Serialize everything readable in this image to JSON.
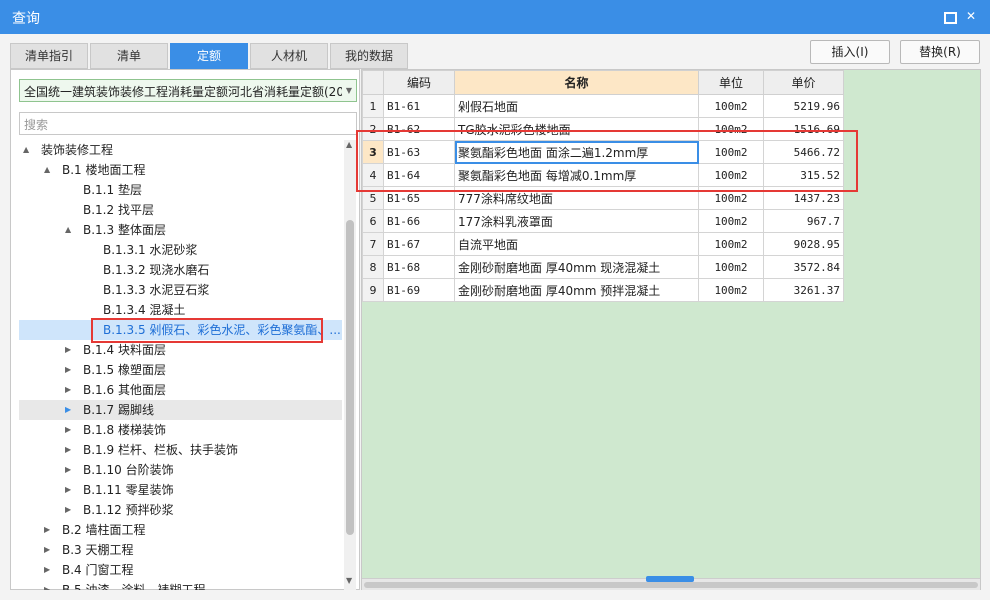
{
  "window": {
    "title": "查询"
  },
  "tabs": [
    {
      "label": "清单指引",
      "active": false
    },
    {
      "label": "清单",
      "active": false
    },
    {
      "label": "定额",
      "active": true
    },
    {
      "label": "人材机",
      "active": false
    },
    {
      "label": "我的数据",
      "active": false
    }
  ],
  "actions": {
    "insert_label": "插入(I)",
    "replace_label": "替换(R)"
  },
  "library": {
    "selected": "全国统一建筑装饰装修工程消耗量定额河北省消耗量定额(20"
  },
  "search": {
    "placeholder": "搜索"
  },
  "tree": [
    {
      "label": "装饰装修工程",
      "arrow": "▲",
      "level": 0
    },
    {
      "label": "B.1 楼地面工程",
      "arrow": "▲",
      "level": 1
    },
    {
      "label": "B.1.1 垫层",
      "arrow": "",
      "level": 2
    },
    {
      "label": "B.1.2 找平层",
      "arrow": "",
      "level": 2
    },
    {
      "label": "B.1.3 整体面层",
      "arrow": "▲",
      "level": 2
    },
    {
      "label": "B.1.3.1 水泥砂浆",
      "arrow": "",
      "level": 3
    },
    {
      "label": "B.1.3.2 现浇水磨石",
      "arrow": "",
      "level": 3
    },
    {
      "label": "B.1.3.3 水泥豆石浆",
      "arrow": "",
      "level": 3
    },
    {
      "label": "B.1.3.4 混凝土",
      "arrow": "",
      "level": 3
    },
    {
      "label": "B.1.3.5 剁假石、彩色水泥、彩色聚氨酯、...",
      "arrow": "",
      "level": 3,
      "selected": true
    },
    {
      "label": "B.1.4 块料面层",
      "arrow": "▶",
      "level": 2
    },
    {
      "label": "B.1.5 橡塑面层",
      "arrow": "▶",
      "level": 2
    },
    {
      "label": "B.1.6 其他面层",
      "arrow": "▶",
      "level": 2
    },
    {
      "label": "B.1.7 踢脚线",
      "arrow": "▶",
      "level": 2,
      "hover": true
    },
    {
      "label": "B.1.8 楼梯装饰",
      "arrow": "▶",
      "level": 2
    },
    {
      "label": "B.1.9 栏杆、栏板、扶手装饰",
      "arrow": "▶",
      "level": 2
    },
    {
      "label": "B.1.10 台阶装饰",
      "arrow": "▶",
      "level": 2
    },
    {
      "label": "B.1.11 零星装饰",
      "arrow": "▶",
      "level": 2
    },
    {
      "label": "B.1.12 预拌砂浆",
      "arrow": "▶",
      "level": 2
    },
    {
      "label": "B.2 墙柱面工程",
      "arrow": "▶",
      "level": 1
    },
    {
      "label": "B.3 天棚工程",
      "arrow": "▶",
      "level": 1
    },
    {
      "label": "B.4 门窗工程",
      "arrow": "▶",
      "level": 1
    },
    {
      "label": "B.5 油漆、涂料、裱糊工程",
      "arrow": "▶",
      "level": 1
    }
  ],
  "grid": {
    "columns": [
      "编码",
      "名称",
      "单位",
      "单价"
    ],
    "rows": [
      {
        "index": "1",
        "code": "B1-61",
        "name": "剁假石地面",
        "unit": "100m2",
        "price": "5219.96"
      },
      {
        "index": "2",
        "code": "B1-62",
        "name": "TG胶水泥彩色楼地面",
        "unit": "100m2",
        "price": "1516.69"
      },
      {
        "index": "3",
        "code": "B1-63",
        "name": "聚氨酯彩色地面 面涂二遍1.2mm厚",
        "unit": "100m2",
        "price": "5466.72",
        "current": true
      },
      {
        "index": "4",
        "code": "B1-64",
        "name": "聚氨酯彩色地面 每增减0.1mm厚",
        "unit": "100m2",
        "price": "315.52"
      },
      {
        "index": "5",
        "code": "B1-65",
        "name": "777涂料席纹地面",
        "unit": "100m2",
        "price": "1437.23"
      },
      {
        "index": "6",
        "code": "B1-66",
        "name": "177涂料乳液罩面",
        "unit": "100m2",
        "price": "967.7"
      },
      {
        "index": "7",
        "code": "B1-67",
        "name": "自流平地面",
        "unit": "100m2",
        "price": "9028.95"
      },
      {
        "index": "8",
        "code": "B1-68",
        "name": "金刚砂耐磨地面 厚40mm 现浇混凝土",
        "unit": "100m2",
        "price": "3572.84"
      },
      {
        "index": "9",
        "code": "B1-69",
        "name": "金刚砂耐磨地面 厚40mm 预拌混凝土",
        "unit": "100m2",
        "price": "3261.37"
      }
    ]
  },
  "icons": {
    "restore": "restore-icon",
    "close": "close-icon",
    "dropdown": "chevron-down-icon"
  },
  "colors": {
    "accent": "#3a8ee6",
    "highlight_box": "#e53935",
    "selected_row": "#cfe5fb",
    "grid_background": "#cfe8cf"
  }
}
